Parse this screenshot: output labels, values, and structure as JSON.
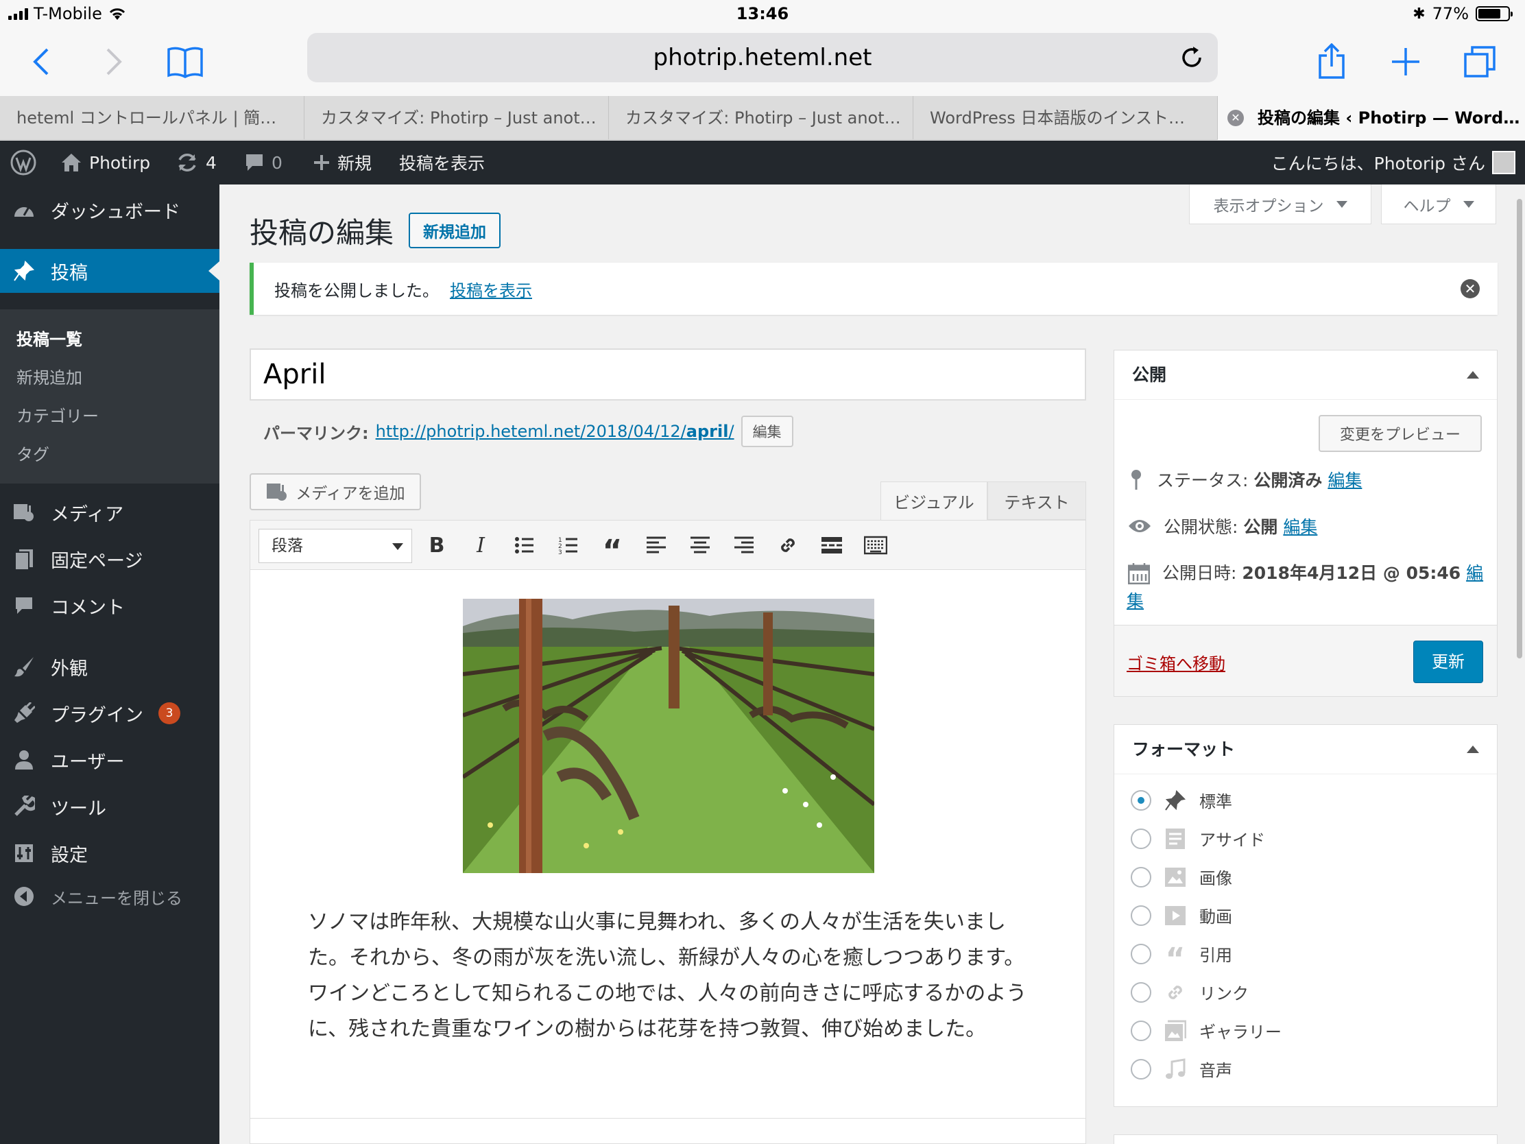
{
  "status_bar": {
    "carrier": "T-Mobile",
    "time": "13:46",
    "battery": "77%"
  },
  "browser": {
    "url": "photrip.heteml.net",
    "tabs": [
      {
        "label": "heteml コントロールパネル | 簡…"
      },
      {
        "label": "カスタマイズ: Photirp – Just anot…"
      },
      {
        "label": "カスタマイズ: Photirp – Just anot…"
      },
      {
        "label": "WordPress 日本語版のインスト…"
      },
      {
        "label": "投稿の編集 ‹ Photirp — WordP…"
      }
    ]
  },
  "adminbar": {
    "site": "Photirp",
    "updates": "4",
    "comments": "0",
    "new": "新規",
    "view_post": "投稿を表示",
    "greeting": "こんにちは、Photorip さん"
  },
  "sidebar": {
    "dashboard": "ダッシュボード",
    "posts": "投稿",
    "sub": [
      "投稿一覧",
      "新規追加",
      "カテゴリー",
      "タグ"
    ],
    "media": "メディア",
    "pages": "固定ページ",
    "comments": "コメント",
    "appearance": "外観",
    "plugins": "プラグイン",
    "plugins_badge": "3",
    "users": "ユーザー",
    "tools": "ツール",
    "settings": "設定",
    "collapse": "メニューを閉じる"
  },
  "page": {
    "title": "投稿の編集",
    "add_new": "新規追加",
    "screen_options": "表示オプション",
    "help": "ヘルプ",
    "notice": "投稿を公開しました。",
    "notice_link": "投稿を表示"
  },
  "post": {
    "title": "April",
    "permalink_label": "パーマリンク:",
    "permalink_base": "http://photrip.heteml.net/2018/04/12/",
    "permalink_slug": "april",
    "permalink_tail": "/",
    "edit": "編集",
    "add_media": "メディアを追加",
    "tab_visual": "ビジュアル",
    "tab_text": "テキスト",
    "format_select": "段落",
    "body": "ソノマは昨年秋、大規模な山火事に見舞われ、多くの人々が生活を失いました。それから、冬の雨が灰を洗い流し、新緑が人々の心を癒しつつあります。ワインどころとして知られるこの地では、人々の前向きさに呼応するかのように、残された貴重なワインの樹からは花芽を持つ敦賀、伸び始めました。"
  },
  "publish": {
    "title": "公開",
    "preview": "変更をプレビュー",
    "status_label": "ステータス:",
    "status_value": "公開済み",
    "visibility_label": "公開状態:",
    "visibility_value": "公開",
    "date_label": "公開日時:",
    "date_value": "2018年4月12日 @ 05:46",
    "edit": "編集",
    "edit_a": "編",
    "edit_b": "集",
    "trash": "ゴミ箱へ移動",
    "update": "更新"
  },
  "format_box": {
    "title": "フォーマット",
    "options": [
      "標準",
      "アサイド",
      "画像",
      "動画",
      "引用",
      "リンク",
      "ギャラリー",
      "音声"
    ],
    "selected": "標準"
  },
  "colors": {
    "admin_dark": "#23282d",
    "accent": "#0073aa",
    "success": "#46b450",
    "danger": "#a00"
  }
}
